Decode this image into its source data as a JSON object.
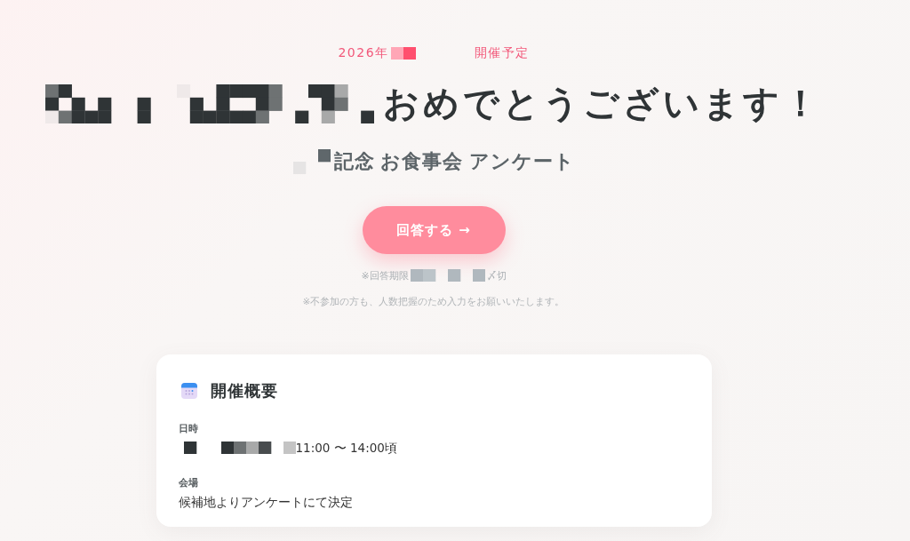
{
  "event_date": {
    "segments": [
      {
        "kind": "text",
        "text": "2026年"
      },
      {
        "kind": "mosaic"
      },
      {
        "kind": "text",
        "text": "開催予定"
      }
    ]
  },
  "headline": {
    "segments": [
      {
        "kind": "mosaic"
      },
      {
        "kind": "text",
        "text": "おめでとうございます！"
      }
    ]
  },
  "subtitle": {
    "segments": [
      {
        "kind": "mosaic"
      },
      {
        "kind": "text",
        "text": "記念 お食事会 アンケート"
      }
    ]
  },
  "answer_button": {
    "label": "回答する →"
  },
  "deadline": {
    "segments": [
      {
        "kind": "text",
        "text": "※回答期限"
      },
      {
        "kind": "mosaic"
      },
      {
        "kind": "text",
        "text": "〆切"
      }
    ]
  },
  "note": "※不参加の方も、人数把握のため入力をお願いいたします。",
  "overview_card": {
    "title": "開催概要",
    "fields": [
      {
        "label": "日時",
        "segments": [
          {
            "kind": "mosaic"
          },
          {
            "kind": "text",
            "text": "11:00 〜 14:00頃"
          }
        ]
      },
      {
        "label": "会場",
        "segments": [
          {
            "kind": "text",
            "text": "候補地よりアンケートにて決定"
          }
        ]
      }
    ]
  }
}
